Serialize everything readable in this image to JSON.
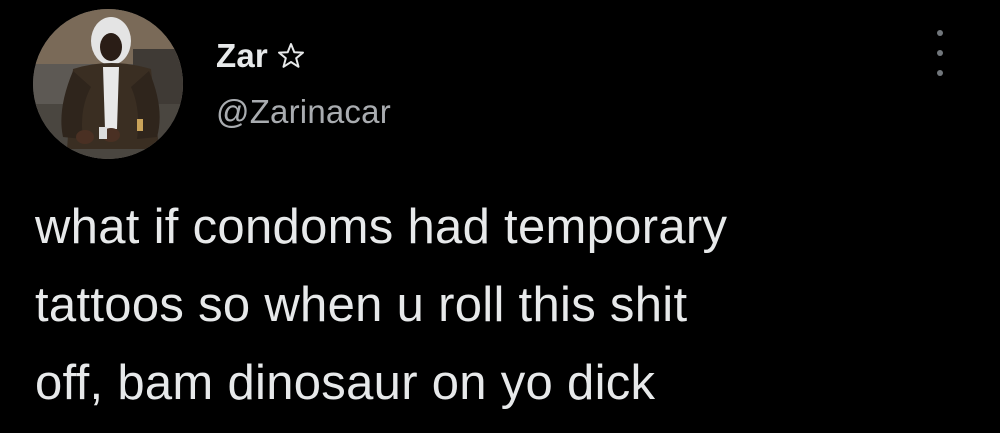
{
  "tweet": {
    "author": {
      "display_name": "Zar",
      "handle": "@Zarinacar",
      "badge_icon": "star-outline-icon",
      "avatar_icon": "profile-photo"
    },
    "text_lines": [
      "what if condoms had temporary",
      "tattoos so when u roll this shit",
      "off, bam dinosaur on yo dick"
    ],
    "menu_icon": "more-options-icon"
  },
  "colors": {
    "background": "#000000",
    "text_primary": "#e7e9ea",
    "text_secondary": "#a9acb0",
    "icon_muted": "#71767b"
  }
}
